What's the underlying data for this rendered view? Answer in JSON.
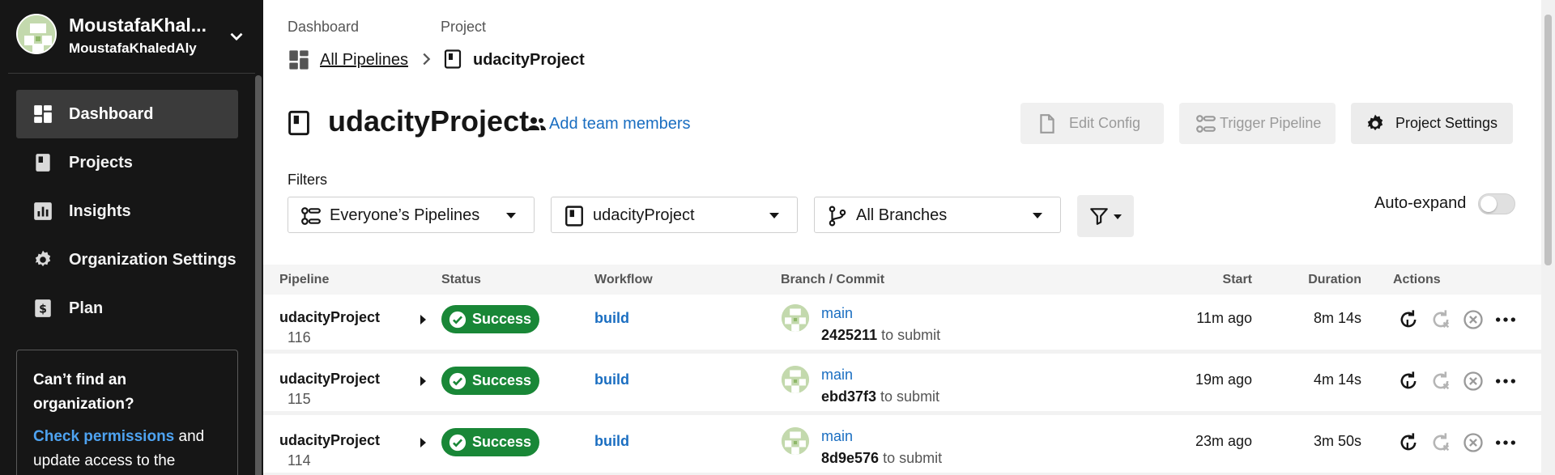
{
  "org": {
    "name": "MoustafaKhal...",
    "username": "MoustafaKhaledAly"
  },
  "nav": [
    {
      "label": "Dashboard",
      "icon": "dashboard-icon",
      "active": true
    },
    {
      "label": "Projects",
      "icon": "projects-icon"
    },
    {
      "label": "Insights",
      "icon": "insights-icon"
    },
    {
      "label": "Organization Settings",
      "icon": "gear-icon"
    },
    {
      "label": "Plan",
      "icon": "plan-icon"
    }
  ],
  "help": {
    "title": "Can’t find an organization?",
    "link": "Check permissions",
    "text": " and update access to the"
  },
  "breadcrumb": {
    "dashboard_label": "Dashboard",
    "project_label": "Project",
    "all_pipelines": "All Pipelines",
    "project": "udacityProject"
  },
  "page": {
    "title": "udacityProject",
    "add_team": "Add team members"
  },
  "buttons": {
    "edit_config": "Edit Config",
    "trigger_pipeline": "Trigger Pipeline",
    "project_settings": "Project Settings"
  },
  "filters": {
    "label": "Filters",
    "pipelines": "Everyone’s Pipelines",
    "project": "udacityProject",
    "branches": "All Branches",
    "auto_expand": "Auto-expand",
    "auto_expand_on": false
  },
  "table": {
    "headers": {
      "pipeline": "Pipeline",
      "status": "Status",
      "workflow": "Workflow",
      "branch_commit": "Branch / Commit",
      "start": "Start",
      "duration": "Duration",
      "actions": "Actions"
    },
    "rows": [
      {
        "pipeline": "udacityProject",
        "number": "116",
        "status": "Success",
        "workflow": "build",
        "branch": "main",
        "sha": "2425211",
        "message": " to submit",
        "start": "11m ago",
        "duration": "8m 14s"
      },
      {
        "pipeline": "udacityProject",
        "number": "115",
        "status": "Success",
        "workflow": "build",
        "branch": "main",
        "sha": "ebd37f3",
        "message": " to submit",
        "start": "19m ago",
        "duration": "4m 14s"
      },
      {
        "pipeline": "udacityProject",
        "number": "114",
        "status": "Success",
        "workflow": "build",
        "branch": "main",
        "sha": "8d9e576",
        "message": " to submit",
        "start": "23m ago",
        "duration": "3m 50s"
      }
    ]
  },
  "colors": {
    "sidebar_bg": "#161616",
    "success": "#198737",
    "link": "#1a6ec1",
    "help_link": "#4ea3f1"
  }
}
